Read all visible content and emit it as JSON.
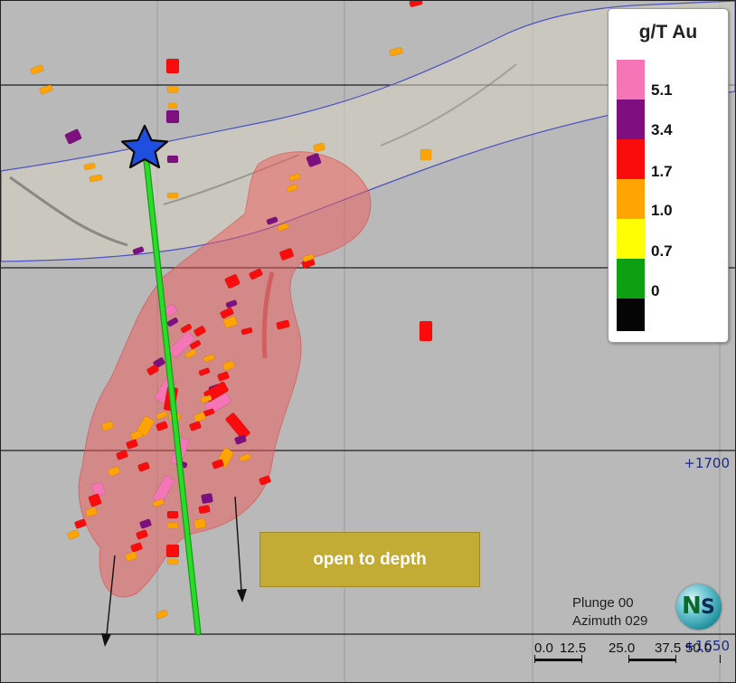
{
  "legend": {
    "title": "g/T Au",
    "items": [
      {
        "label": "5.1",
        "color": "#f576b6"
      },
      {
        "label": "3.4",
        "color": "#7e0f80"
      },
      {
        "label": "1.7",
        "color": "#fb0c0c"
      },
      {
        "label": "1.0",
        "color": "#ffa402"
      },
      {
        "label": "0.7",
        "color": "#fffe03"
      },
      {
        "label": "0",
        "color": "#0f9f12"
      },
      {
        "label": "",
        "color": "#050505"
      }
    ]
  },
  "elevations": [
    "+1700",
    "+1650"
  ],
  "callout": {
    "text": "open to depth",
    "color": "#c2ac35"
  },
  "orientation": {
    "plunge": "Plunge 00",
    "azimuth": "Azimuth 029"
  },
  "compass": {
    "n": "N",
    "s": "S"
  },
  "scalebar": {
    "labels": [
      "0.0",
      "12.5",
      "25.0",
      "37.5",
      "50.0"
    ]
  },
  "colors": {
    "background": "#b9b9b9",
    "drillhole": "#20d020",
    "envelope": "#f05a5a",
    "star": "#1e4fe0"
  }
}
